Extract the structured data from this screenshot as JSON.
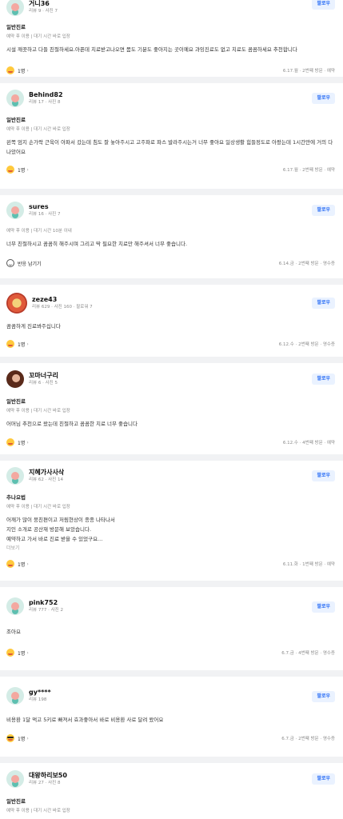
{
  "follow_label": "팔로우",
  "more_label": "더보기",
  "reviews": [
    {
      "name": "거니36",
      "meta": "리뷰 9 · 사진 7",
      "visit_type": "일반진료",
      "chips": "예약 후 이용 | 대기 시간 바로 입장",
      "body": "시설 깨끗하고 다들 친절하세요.아픈데 치료받고나오면 몸도 기분도 좋아지는 곳이예요 과잉진료도 없고 치료도 꼼꼼하세요 추천합니다",
      "reaction": "1명",
      "date": "6.17.월 · 2번째 방문 · 예약"
    },
    {
      "name": "Behind82",
      "meta": "리뷰 17 · 사진 8",
      "visit_type": "일반진료",
      "chips": "예약 후 이용 | 대기 시간 바로 입장",
      "body": "왼쪽 엄지 손가락 근육이 아파서 갔는데 침도 잘 놓아주시고 고주파로 파스 발라주시는거 너무 좋아요 일상생활 힘들정도로 아팠는데 1시간만에 거의 다 나았어요",
      "reaction": "1명",
      "date": "6.17.월 · 2번째 방문 · 예약"
    },
    {
      "name": "sures",
      "meta": "리뷰 16 · 사진 7",
      "chips": "예약 후 이용 | 대기 시간 10분 이내",
      "body": "너무 친절하시고 꼼꼼히 해주시며 그리고 딱 필요한 치료만 해주셔서 너무 좋습니다.",
      "reaction": "반응 남기기",
      "date": "6.14.금 · 2번째 방문 · 영수증"
    },
    {
      "name": "zeze43",
      "meta": "리뷰 629 · 사진 160 · 팔로워 7",
      "body": "꼼꼼하게 진료봐주십니다",
      "reaction": "1명",
      "date": "6.12.수 · 2번째 방문 · 영수증"
    },
    {
      "name": "꼬마너구리",
      "meta": "리뷰 6 · 사진 5",
      "visit_type": "일반진료",
      "chips": "예약 후 이용 | 대기 시간 바로 입장",
      "body": "어머님 추천으로 왔는데 친절하고 꼼꼼한 치료 너무 좋습니다",
      "reaction": "1명",
      "date": "6.12.수 · 4번째 방문 · 예약"
    },
    {
      "name": "지혜가사사삭",
      "meta": "리뷰 62 · 사진 14",
      "visit_type": "추나요법",
      "chips": "예약 후 이용 | 대기 시간 바로 입장",
      "body_lines": [
        "어깨가 많이 뭉친편이고 저림현상이 종종 나타나서",
        "지인 소개로 공산재 방문해 보았습니다.",
        "예약하고 가서 바로 진료 받을 수 있었구요..."
      ],
      "reaction": "1명",
      "date": "6.11.화 · 1번째 방문 · 예약"
    },
    {
      "name": "pink752",
      "meta": "리뷰 777 · 사진 2",
      "body": "조아요",
      "reaction": "1명",
      "date": "6.7.금 · 4번째 방문 · 영수증"
    },
    {
      "name": "gy****",
      "meta": "리뷰 198",
      "body": "비용환 1달 먹고 5키로 빠져서 효과좋아서 바로 비용환 사로 달려 왔어요",
      "reaction": "1명",
      "date": "6.7.금 · 2번째 방문 · 영수증"
    },
    {
      "name": "대왕하리보50",
      "meta": "리뷰 27 · 사진 8",
      "visit_type": "일반진료",
      "chips": "예약 후 이용 | 대기 시간 바로 입장"
    }
  ]
}
